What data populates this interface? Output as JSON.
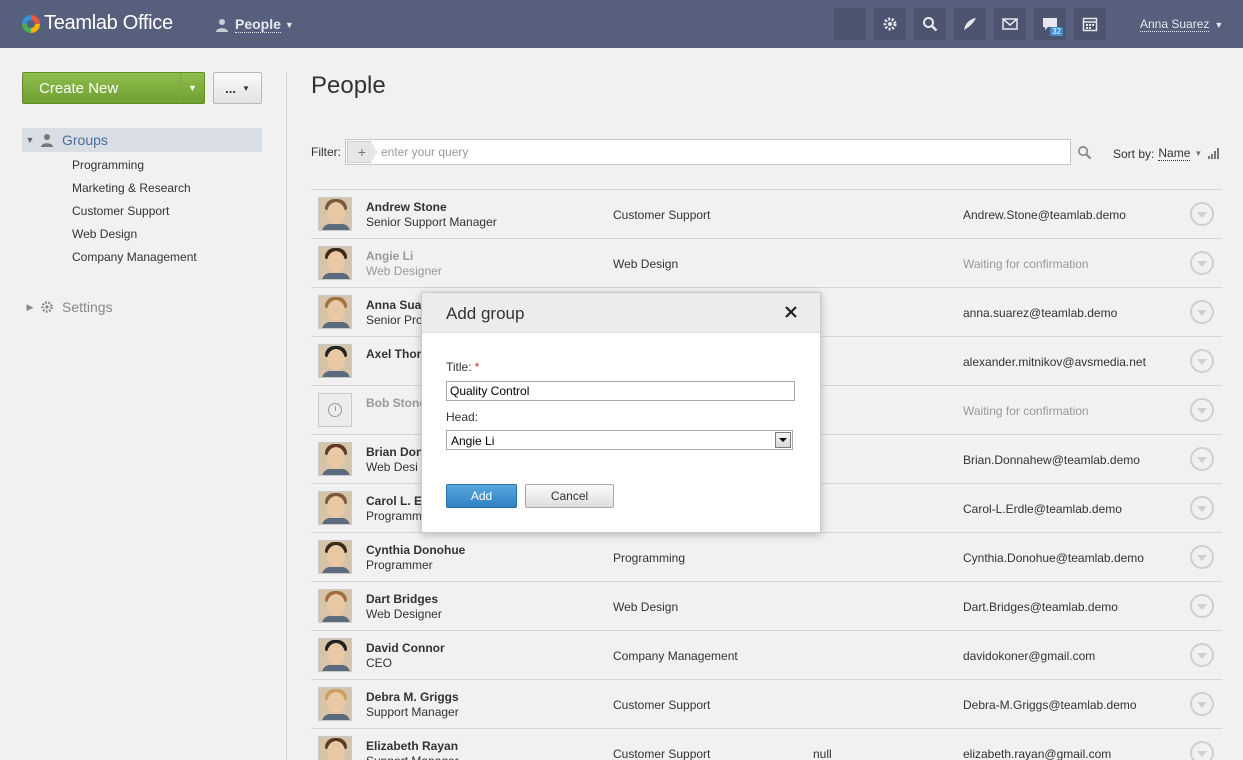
{
  "header": {
    "logo_text": "Teamlab Office",
    "module": "People",
    "user_name": "Anna Suarez",
    "chat_badge": "32"
  },
  "sidebar": {
    "create_label": "Create New",
    "more_label": "...",
    "groups_label": "Groups",
    "groups": [
      "Programming",
      "Marketing & Research",
      "Customer Support",
      "Web Design",
      "Company Management"
    ],
    "settings_label": "Settings"
  },
  "main": {
    "title": "People",
    "filter_label": "Filter:",
    "filter_placeholder": "enter your query",
    "sort_label": "Sort by:",
    "sort_value": "Name"
  },
  "people": [
    {
      "name": "Andrew Stone",
      "title": "Senior Support Manager",
      "dept": "Customer Support",
      "extra": "",
      "email": "Andrew.Stone@teamlab.demo",
      "pending": false
    },
    {
      "name": "Angie Li",
      "title": "Web Designer",
      "dept": "Web Design",
      "extra": "",
      "email": "Waiting for confirmation",
      "pending": true
    },
    {
      "name": "Anna Suar",
      "title": "Senior Pro",
      "dept": "",
      "extra": "",
      "email": "anna.suarez@teamlab.demo",
      "pending": false
    },
    {
      "name": "Axel Thorn",
      "title": "",
      "dept": "",
      "extra": "",
      "email": "alexander.mitnikov@avsmedia.net",
      "pending": false
    },
    {
      "name": "Bob Stone",
      "title": "",
      "dept": "",
      "extra": "",
      "email": "Waiting for confirmation",
      "pending": true
    },
    {
      "name": "Brian Don",
      "title": "Web Desi",
      "dept": "",
      "extra": "",
      "email": "Brian.Donnahew@teamlab.demo",
      "pending": false
    },
    {
      "name": "Carol L. Er",
      "title": "Programm",
      "dept": "",
      "extra": "",
      "email": "Carol-L.Erdle@teamlab.demo",
      "pending": false
    },
    {
      "name": "Cynthia Donohue",
      "title": "Programmer",
      "dept": "Programming",
      "extra": "",
      "email": "Cynthia.Donohue@teamlab.demo",
      "pending": false
    },
    {
      "name": "Dart Bridges",
      "title": "Web Designer",
      "dept": "Web Design",
      "extra": "",
      "email": "Dart.Bridges@teamlab.demo",
      "pending": false
    },
    {
      "name": "David Connor",
      "title": "CEO",
      "dept": "Company Management",
      "extra": "",
      "email": "davidokoner@gmail.com",
      "pending": false
    },
    {
      "name": "Debra M. Griggs",
      "title": "Support Manager",
      "dept": "Customer Support",
      "extra": "",
      "email": "Debra-M.Griggs@teamlab.demo",
      "pending": false
    },
    {
      "name": "Elizabeth Rayan",
      "title": "Support Manager",
      "dept": "Customer Support",
      "extra": "null",
      "email": "elizabeth.rayan@gmail.com",
      "pending": false
    }
  ],
  "dialog": {
    "title": "Add group",
    "title_label": "Title:",
    "required_mark": "*",
    "title_value": "Quality Control",
    "head_label": "Head:",
    "head_value": "Angie Li",
    "add_label": "Add",
    "cancel_label": "Cancel"
  },
  "colors": {
    "topbar": "#565f7c",
    "create_button": "#7aac3a",
    "primary_button": "#3d8fd1",
    "link": "#4a6f9c"
  }
}
